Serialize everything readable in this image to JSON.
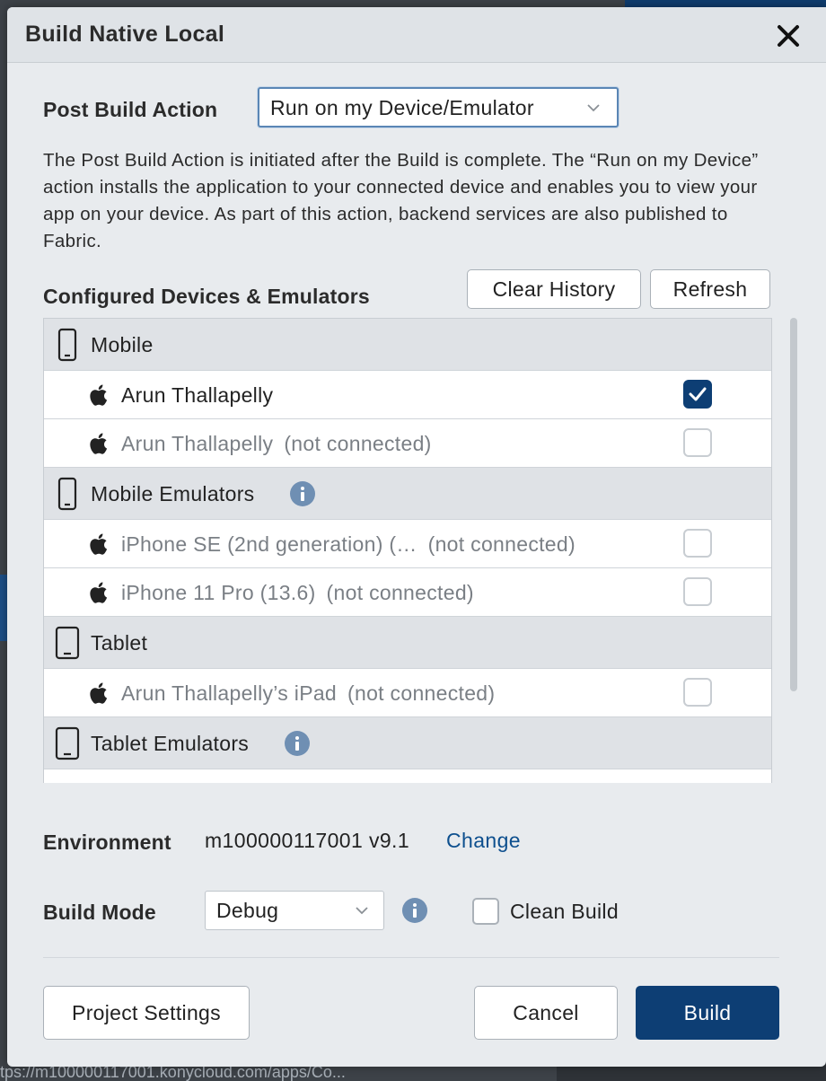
{
  "background": {
    "url_fragment": "tps://m100000117001.konycloud.com/apps/Co..."
  },
  "dialog": {
    "title": "Build Native Local",
    "close_symbol": "✕",
    "post_build_action": {
      "label": "Post Build Action",
      "selected": "Run on my Device/Emulator"
    },
    "description": "The Post Build Action is initiated after the Build is complete. The “Run on my Device” action installs the application to your connected device and enables you to view your app on your device. As part of this action, backend services are also published to Fabric.",
    "devices": {
      "label": "Configured Devices & Emulators",
      "clear_history": "Clear History",
      "refresh": "Refresh",
      "groups": [
        {
          "label": "Mobile",
          "icon": "mobile-phone-icon",
          "info": false
        },
        {
          "label": "Mobile Emulators",
          "icon": "mobile-phone-icon",
          "info": true
        },
        {
          "label": "Tablet",
          "icon": "tablet-icon",
          "info": false
        },
        {
          "label": "Tablet Emulators",
          "icon": "tablet-icon",
          "info": true
        }
      ],
      "items": [
        {
          "name": "Arun Thallapelly",
          "status": "",
          "checked": true
        },
        {
          "name": "Arun Thallapelly",
          "status": "(not connected)",
          "checked": false
        },
        {
          "name": "iPhone SE (2nd generation) (…",
          "status": "(not connected)",
          "checked": false
        },
        {
          "name": "iPhone 11 Pro (13.6)",
          "status": "(not connected)",
          "checked": false
        },
        {
          "name": "Arun Thallapelly’s iPad",
          "status": "(not connected)",
          "checked": false
        }
      ]
    },
    "environment": {
      "label": "Environment",
      "value": "m100000117001 v9.1",
      "change": "Change"
    },
    "build_mode": {
      "label": "Build Mode",
      "selected": "Debug",
      "clean_build_label": "Clean Build",
      "clean_build_checked": false
    },
    "footer": {
      "project_settings": "Project Settings",
      "cancel": "Cancel",
      "build": "Build"
    }
  },
  "colors": {
    "primary": "#0d3e74",
    "link": "#0d4f8e",
    "info": "#6f8fb3"
  }
}
